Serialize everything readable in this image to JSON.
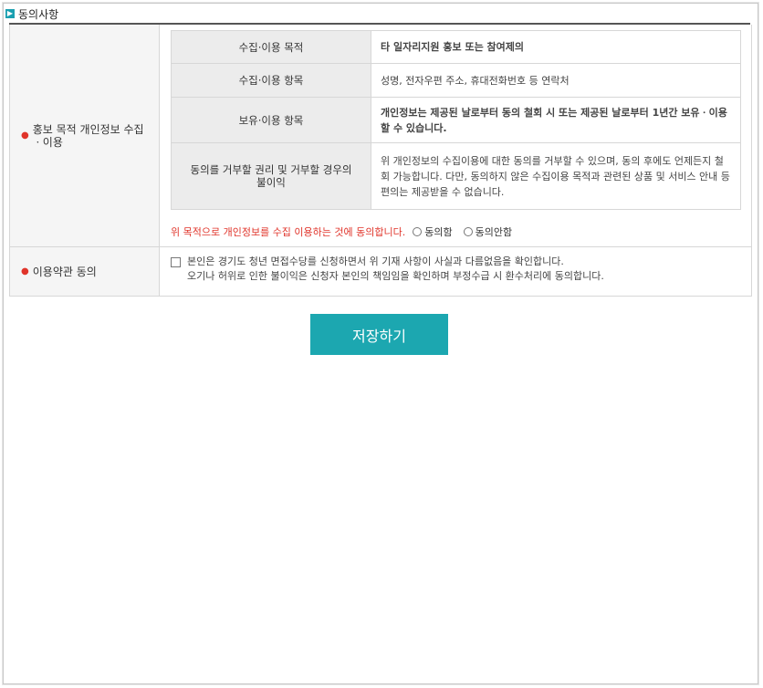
{
  "section": {
    "icon": "arrow-right-icon",
    "title": "동의사항"
  },
  "privacy": {
    "label": "홍보 목적 개인정보 수집ㆍ이용",
    "rows": [
      {
        "header": "수집·이용 목적",
        "value": "타 일자리지원 홍보 또는 참여제의"
      },
      {
        "header": "수집·이용 항목",
        "value": "성명, 전자우편 주소, 휴대전화번호 등 연락처"
      },
      {
        "header": "보유·이용 항목",
        "value": "개인정보는 제공된 날로부터 동의 철회 시 또는 제공된 날로부터 1년간 보유ㆍ이용할 수 있습니다."
      },
      {
        "header": "동의를 거부할 권리 및 거부할 경우의 불이익",
        "value": "위 개인정보의 수집이용에 대한 동의를 거부할 수 있으며, 동의 후에도 언제든지 철회 가능합니다. 다만, 동의하지 않은 수집이용 목적과 관련된 상품 및 서비스 안내 등 편의는 제공받을 수 없습니다."
      }
    ],
    "agree_text": "위 목적으로 개인정보를 수집 이용하는 것에 동의합니다.",
    "radio_agree": "동의함",
    "radio_disagree": "동의안함"
  },
  "terms": {
    "label": "이용약관 동의",
    "line1": "본인은 경기도 청년 면접수당를 신청하면서 위 기재 사항이 사실과 다름없음을 확인합니다.",
    "line2": "오기나 허위로 인한 불이익은 신청자 본인의 책임임을 확인하며 부정수급 시 환수처리에 동의합니다."
  },
  "save_button": "저장하기",
  "colors": {
    "accent": "#1ca7b0",
    "highlight": "#e0342a"
  }
}
